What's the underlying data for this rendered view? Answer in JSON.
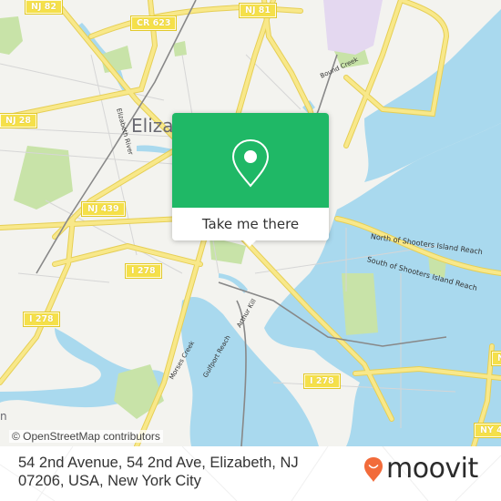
{
  "map": {
    "city_label": "Elizabeth",
    "partial_label_bottom_left": "n",
    "road_shields": [
      {
        "id": "nj82",
        "label": "NJ 82"
      },
      {
        "id": "cr623",
        "label": "CR 623"
      },
      {
        "id": "nj81",
        "label": "NJ 81"
      },
      {
        "id": "nj28",
        "label": "NJ 28"
      },
      {
        "id": "nj439",
        "label": "NJ 439"
      },
      {
        "id": "i278a",
        "label": "I 278"
      },
      {
        "id": "i278b",
        "label": "I 278"
      },
      {
        "id": "i278c",
        "label": "I 278"
      },
      {
        "id": "ny4x",
        "label": "NY 4"
      },
      {
        "id": "nright",
        "label": "N"
      }
    ],
    "water_labels": {
      "elizabeth_river": "Elizabeth River",
      "bound_creek": "Bound Creek",
      "north_reach": "North of Shooters Island Reach",
      "south_reach": "South of Shooters Island Reach",
      "arthur_kill": "Arthur Kill",
      "gulfport_reach": "Gulfport Reach",
      "morses_creek": "Morses Creek"
    },
    "attribution": "© OpenStreetMap contributors",
    "colors": {
      "land": "#f3f3ef",
      "water": "#a9d9ee",
      "park": "#c8e3a8",
      "highway": "#f5e27a",
      "highway_casing": "#e6cf55",
      "rail": "#888888",
      "minor_road": "#d6d6d6"
    }
  },
  "popup": {
    "icon": "map-pin-icon",
    "action_label": "Take me there",
    "accent_color": "#1fb866"
  },
  "footer": {
    "address": "54 2nd Avenue, 54 2nd Ave, Elizabeth, NJ 07206, USA, New York City",
    "brand": "moovit",
    "brand_icon": "moovit-pin-logo-icon",
    "brand_color": "#f26b3a"
  }
}
